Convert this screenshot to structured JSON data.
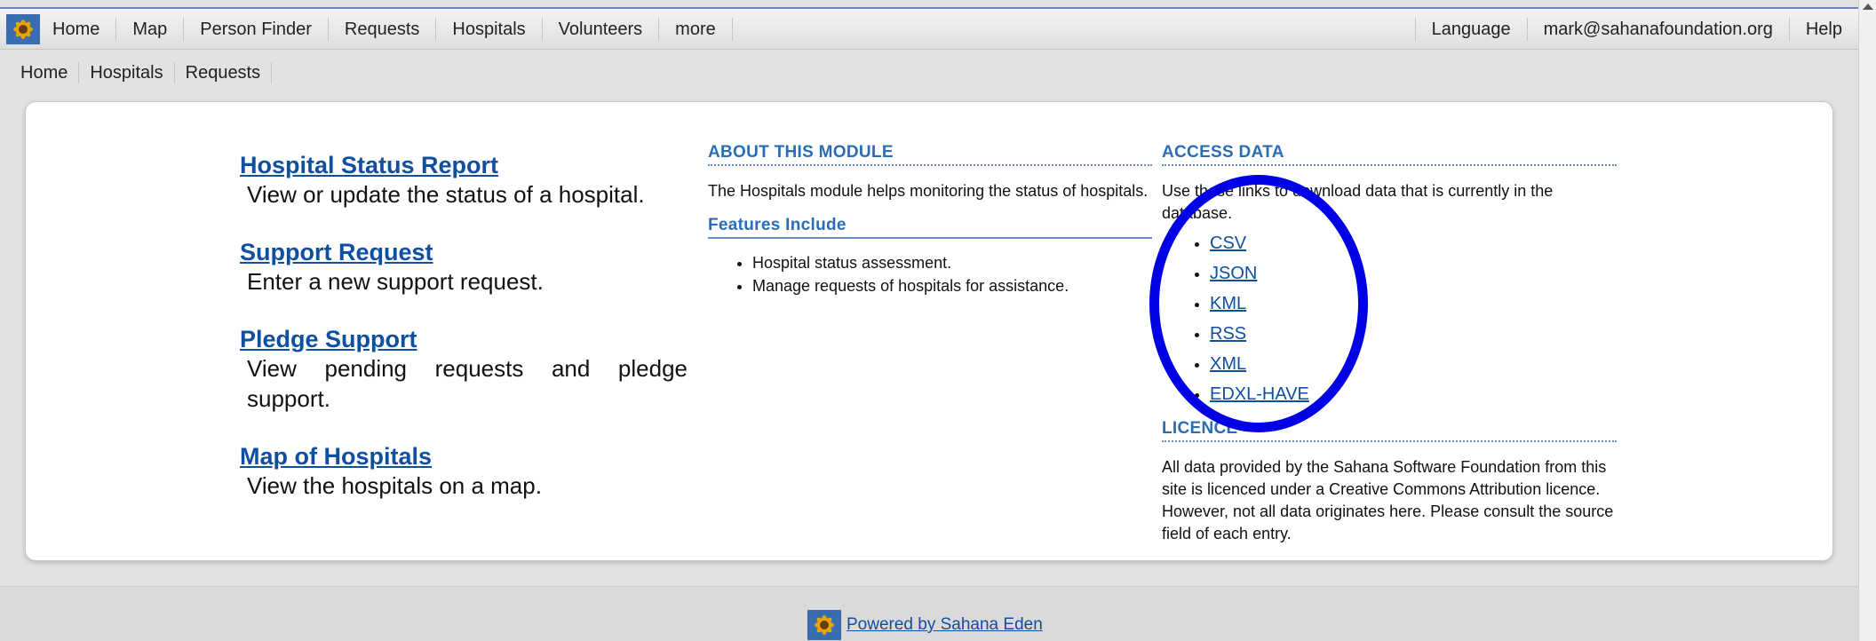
{
  "nav": {
    "left": [
      "Home",
      "Map",
      "Person Finder",
      "Requests",
      "Hospitals",
      "Volunteers",
      "more"
    ],
    "language": "Language",
    "user": "mark@sahanafoundation.org",
    "help": "Help"
  },
  "breadcrumb": [
    "Home",
    "Hospitals",
    "Requests"
  ],
  "menu": [
    {
      "label": "Hospital Status Report",
      "desc": "View or update the status of a hospital."
    },
    {
      "label": "Support Request",
      "desc": "Enter a new support request."
    },
    {
      "label": "Pledge Support",
      "desc": "View pending requests and pledge support."
    },
    {
      "label": "Map of Hospitals",
      "desc": "View the hospitals on a map."
    }
  ],
  "about": {
    "title": "ABOUT THIS MODULE",
    "text": "The Hospitals module helps monitoring the status of hospitals.",
    "features_title": "Features Include",
    "features": [
      "Hospital status assessment.",
      "Manage requests of hospitals for assistance."
    ]
  },
  "access": {
    "title": "ACCESS DATA",
    "text": "Use these links to download data that is currently in the database.",
    "links": [
      "CSV",
      "JSON",
      "KML",
      "RSS",
      "XML",
      "EDXL-HAVE"
    ],
    "licence_title": "LICENCE",
    "licence_text": "All data provided by the Sahana Software Foundation from this site is licenced under a Creative Commons Attribution licence. However, not all data originates here. Please consult the source field of each entry."
  },
  "footer": {
    "link": "Powered by Sahana Eden"
  },
  "colors": {
    "link": "#0f4fa0",
    "section": "#2a6db4",
    "annotation_circle": "#0000e6"
  }
}
